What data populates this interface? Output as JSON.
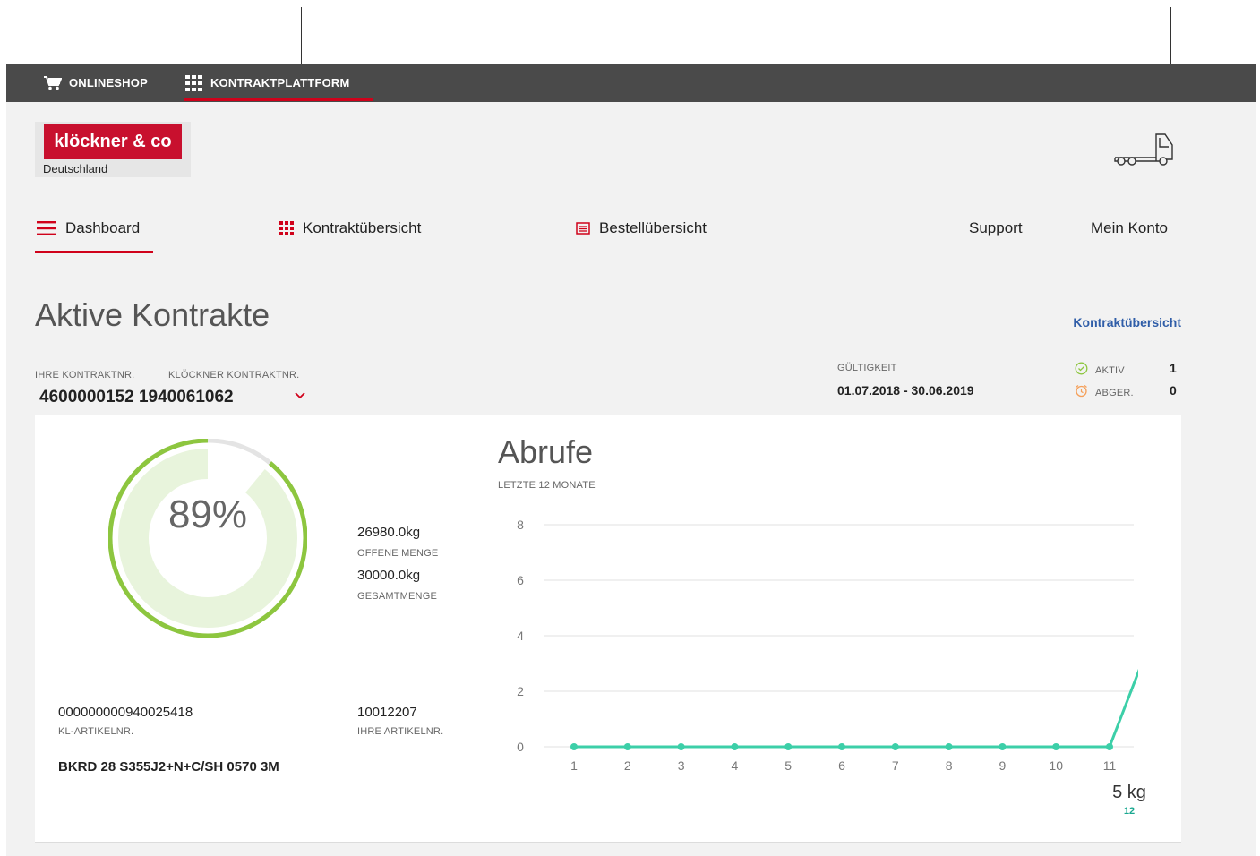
{
  "topbar": {
    "items": [
      {
        "label": "ONLINESHOP",
        "icon": "cart-icon"
      },
      {
        "label": "KONTRAKTPLATTFORM",
        "icon": "grid-icon",
        "active": true
      }
    ]
  },
  "brand": {
    "logo_text": "klöckner & co",
    "sub": "Deutschland",
    "accent_color": "#c8102e"
  },
  "nav": {
    "items": [
      {
        "label": "Dashboard",
        "icon": "menu-icon",
        "active": true
      },
      {
        "label": "Kontraktübersicht",
        "icon": "grid-icon"
      },
      {
        "label": "Bestellübersicht",
        "icon": "list-icon"
      },
      {
        "label": "Support"
      },
      {
        "label": "Mein Konto"
      }
    ],
    "cart_icon": "truck-icon"
  },
  "main": {
    "title": "Aktive Kontrakte",
    "overview_link": "Kontraktübersicht",
    "labels": {
      "ihre_kontraktnr": "IHRE KONTRAKTNR.",
      "kloeckner_kontraktnr": "KLÖCKNER KONTRAKTNR.",
      "gueltigkeit": "GÜLTIGKEIT",
      "aktiv": "AKTIV",
      "abger": "ABGER."
    },
    "contract_numbers": "4600000152 1940061062",
    "gueltigkeit_value": "01.07.2018 - 30.06.2019",
    "aktiv_count": "1",
    "abger_count": "0"
  },
  "card": {
    "percent_text": "89%",
    "percent_value": 0.89,
    "offene_menge_value": "26980.0kg",
    "offene_menge_label": "OFFENE MENGE",
    "gesamtmenge_value": "30000.0kg",
    "gesamtmenge_label": "GESAMTMENGE",
    "kl_artikel_value": "000000000940025418",
    "kl_artikel_label": "KL-ARTIKELNR.",
    "ihre_artikel_value": "10012207",
    "ihre_artikel_label": "IHRE ARTIKELNR.",
    "product_name": "BKRD 28 S355J2+N+C/SH 0570 3M",
    "colors": {
      "ring": "#8dc63f",
      "ring_fill": "#e8f4dc",
      "ring_track": "#e4e4e4",
      "line": "#3ccfa8"
    }
  },
  "chart": {
    "title": "Abrufe",
    "subtitle": "LETZTE 12 MONATE",
    "tooltip_value": "5 kg",
    "tooltip_label": "12"
  },
  "chart_data": {
    "type": "line",
    "x": [
      1,
      2,
      3,
      4,
      5,
      6,
      7,
      8,
      9,
      10,
      11,
      12
    ],
    "series": [
      {
        "values": [
          0,
          0,
          0,
          0,
          0,
          0,
          0,
          0,
          0,
          0,
          0,
          5
        ]
      }
    ],
    "ylim": [
      0,
      8
    ],
    "yticks": [
      0,
      2,
      4,
      6,
      8
    ],
    "highlight_x": 12,
    "grid": true
  }
}
